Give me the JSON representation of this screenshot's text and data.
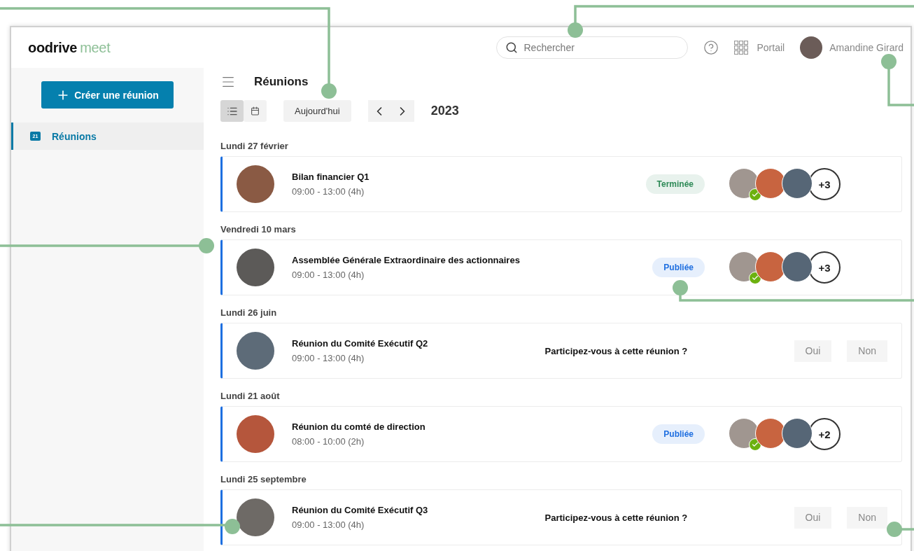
{
  "logo": {
    "brand": "oodrive",
    "product": "meet"
  },
  "header": {
    "search": {
      "placeholder": "Rechercher"
    },
    "portal": "Portail",
    "user": {
      "name": "Amandine Girard"
    }
  },
  "sidebar": {
    "create_button": "Créer une réunion",
    "items": [
      {
        "label": "Réunions",
        "badge": "21",
        "selected": true
      }
    ]
  },
  "main": {
    "title": "Réunions",
    "views": [
      {
        "kind": "list",
        "selected": true
      },
      {
        "kind": "calendar",
        "selected": false
      }
    ],
    "today_button": "Aujourd'hui",
    "year": "2023"
  },
  "days": [
    {
      "date": "Lundi 27 février",
      "meetings": [
        {
          "title": "Bilan financier Q1",
          "time": "09:00 - 13:00 (4h)",
          "kind": "status",
          "status": {
            "label": "Terminée",
            "color": "#2e8a57"
          },
          "participants": [
            {
              "confirmed": true
            },
            {
              "confirmed": false
            },
            {
              "confirmed": false
            }
          ],
          "more": "+3"
        }
      ]
    },
    {
      "date": "Vendredi 10 mars",
      "meetings": [
        {
          "title": "Assemblée Générale Extraordinaire des actionnaires",
          "time": "09:00 - 13:00 (4h)",
          "kind": "status",
          "status": {
            "label": "Publiée",
            "color": "#1f6fe0"
          },
          "participants": [
            {
              "confirmed": true
            },
            {
              "confirmed": false
            },
            {
              "confirmed": false
            }
          ],
          "more": "+3"
        }
      ]
    },
    {
      "date": "Lundi 26 juin",
      "meetings": [
        {
          "title": "Réunion du Comité Exécutif Q2",
          "time": "09:00 - 13:00 (4h)",
          "kind": "rsvp",
          "question": "Participez-vous à cette réunion ?",
          "answers": [
            "Oui",
            "Non"
          ]
        }
      ]
    },
    {
      "date": "Lundi 21 août",
      "meetings": [
        {
          "title": "Réunion du comté de direction",
          "time": "08:00 - 10:00 (2h)",
          "kind": "status",
          "status": {
            "label": "Publiée",
            "color": "#1f6fe0"
          },
          "participants": [
            {
              "confirmed": true
            },
            {
              "confirmed": false
            },
            {
              "confirmed": false
            }
          ],
          "more": "+2"
        }
      ]
    },
    {
      "date": "Lundi 25 septembre",
      "meetings": [
        {
          "title": "Réunion du Comité Exécutif Q3",
          "time": "09:00 - 13:00 (4h)",
          "kind": "rsvp",
          "question": "Participez-vous à cette réunion ?",
          "answers": [
            "Oui",
            "Non"
          ]
        }
      ]
    }
  ]
}
